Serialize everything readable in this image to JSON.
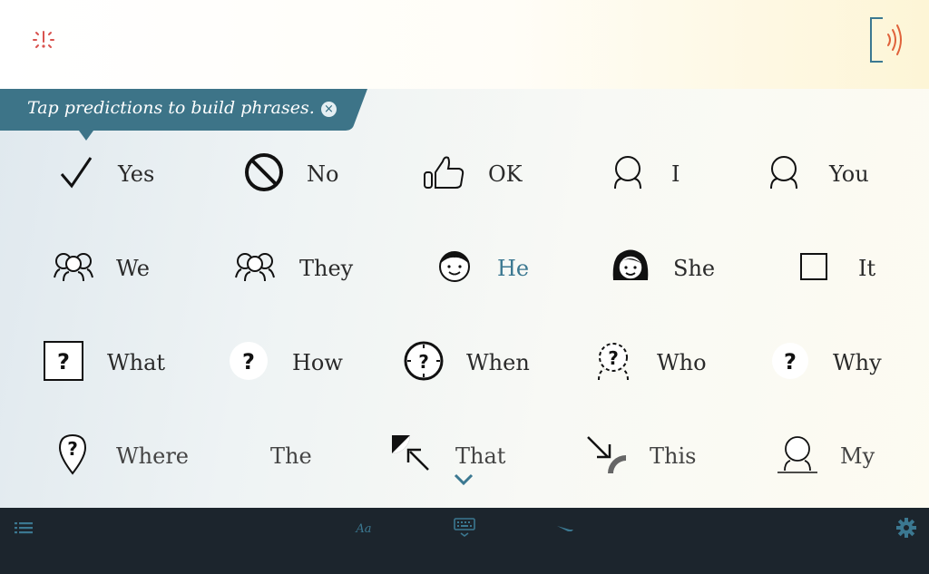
{
  "hint": {
    "text": "Tap predictions to build phrases.",
    "close_label": "×"
  },
  "grid": [
    [
      {
        "label": "Yes",
        "icon": "checkmark-icon"
      },
      {
        "label": "No",
        "icon": "prohibited-icon"
      },
      {
        "label": "OK",
        "icon": "thumbs-up-icon"
      },
      {
        "label": "I",
        "icon": "person-icon"
      },
      {
        "label": "You",
        "icon": "person-icon"
      }
    ],
    [
      {
        "label": "We",
        "icon": "group-icon"
      },
      {
        "label": "They",
        "icon": "group-icon"
      },
      {
        "label": "He",
        "icon": "boy-face-icon",
        "highlighted": true
      },
      {
        "label": "She",
        "icon": "girl-face-icon"
      },
      {
        "label": "It",
        "icon": "square-icon"
      }
    ],
    [
      {
        "label": "What",
        "icon": "question-box-icon"
      },
      {
        "label": "How",
        "icon": "question-circle-icon"
      },
      {
        "label": "When",
        "icon": "question-clock-icon"
      },
      {
        "label": "Who",
        "icon": "question-person-icon"
      },
      {
        "label": "Why",
        "icon": "question-mark-icon"
      }
    ],
    [
      {
        "label": "Where",
        "icon": "question-pin-icon"
      },
      {
        "label": "The",
        "icon": ""
      },
      {
        "label": "That",
        "icon": "arrow-away-icon"
      },
      {
        "label": "This",
        "icon": "arrow-toward-icon"
      },
      {
        "label": "My",
        "icon": "person-mine-icon"
      }
    ]
  ],
  "colors": {
    "accent": "#3b7891",
    "hint_bg": "#3d7488",
    "bottom_bar": "#1c252d",
    "alert": "#d9534f"
  },
  "bottom_bar": {
    "icons": [
      "list-icon",
      "handwriting-icon",
      "keyboard-icon",
      "pen-icon",
      "settings-gear-icon"
    ]
  }
}
